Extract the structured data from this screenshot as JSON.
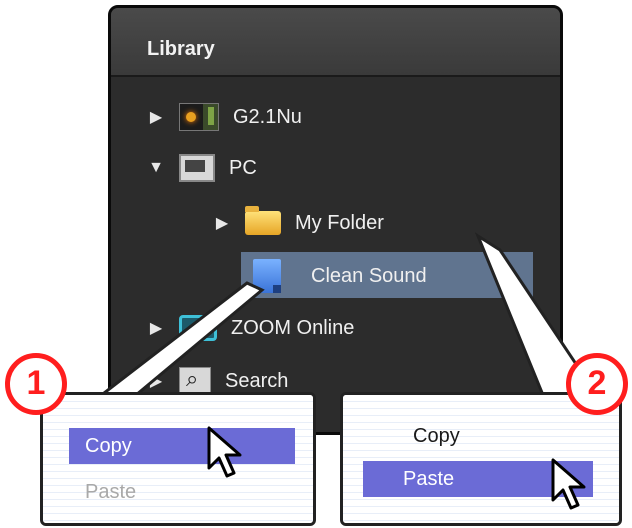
{
  "library": {
    "title": "Library",
    "items": [
      {
        "label": "G2.1Nu",
        "icon": "device-icon",
        "expander": "collapsed"
      },
      {
        "label": "PC",
        "icon": "pc-icon",
        "expander": "expanded"
      },
      {
        "label": "My Folder",
        "icon": "folder-icon",
        "expander": "collapsed"
      },
      {
        "label": "Clean Sound",
        "icon": "patch-file-icon",
        "selected": true
      },
      {
        "label": "ZOOM Online",
        "icon": "online-icon",
        "expander": "collapsed"
      },
      {
        "label": "Search",
        "icon": "search-icon",
        "expander": "collapsed"
      }
    ]
  },
  "callouts": [
    {
      "badge": "1",
      "menu": {
        "copy": "Copy",
        "paste": "Paste"
      },
      "highlighted": "Copy",
      "disabled": "Paste"
    },
    {
      "badge": "2",
      "menu": {
        "copy": "Copy",
        "paste": "Paste"
      },
      "highlighted": "Paste"
    }
  ],
  "colors": {
    "panel_bg": "#2c2c2c",
    "selection": "#60748f",
    "menu_highlight": "#6b6bd6",
    "badge": "#ff1e1e"
  }
}
